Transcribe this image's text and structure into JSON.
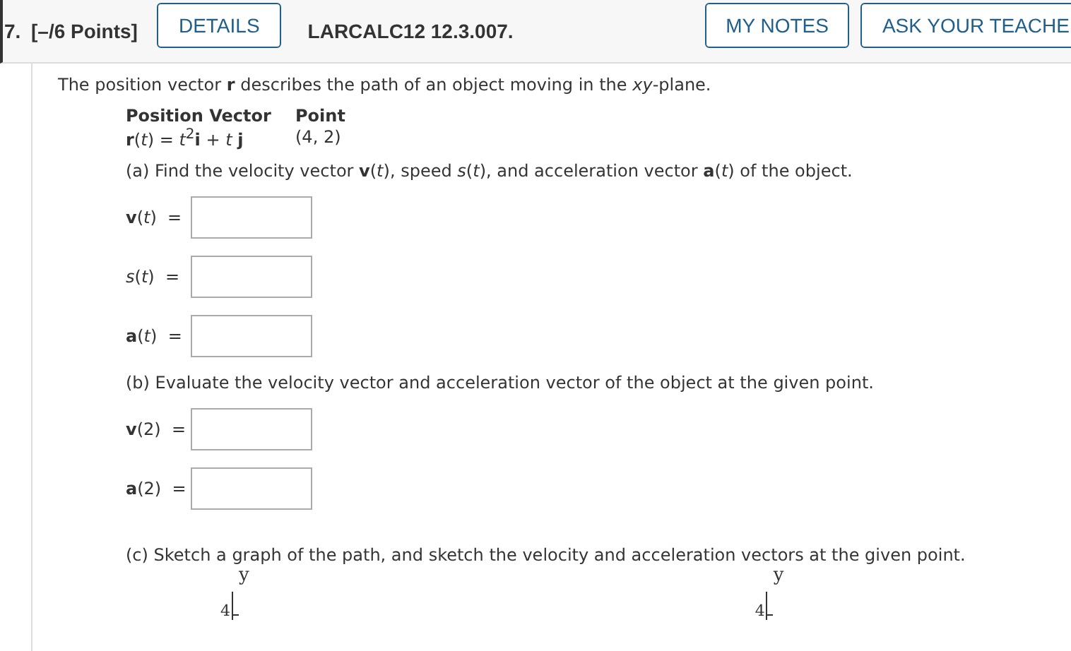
{
  "header": {
    "number": "7.",
    "points": "[–/6 Points]",
    "details_button": "DETAILS",
    "problem_id": "LARCALC12 12.3.007.",
    "buttons": [
      "MY NOTES",
      "ASK YOUR TEACHE"
    ]
  },
  "intro": "The position vector **r** describes the path of an object moving in the *xy*-plane.",
  "given": {
    "headers": [
      "Position Vector",
      "Point"
    ],
    "values": [
      "**r**(*t*) = *t*$^{2}$**i** + *t* **j**",
      "(4, 2)"
    ]
  },
  "parts": [
    {
      "prompt": "(a) Find the velocity vector **v**(*t*), speed *s*(*t*), and acceleration vector **a**(*t*) of the object.",
      "answers": [
        {
          "label": "**v**(*t*)  ="
        },
        {
          "label": "*s*(*t*)  ="
        },
        {
          "label": "**a**(*t*)  ="
        }
      ]
    },
    {
      "prompt": "(b) Evaluate the velocity vector and acceleration vector of the object at the given point.",
      "answers": [
        {
          "label": "**v**(2)  ="
        },
        {
          "label": "**a**(2)  ="
        }
      ]
    },
    {
      "prompt": "(c) Sketch a graph of the path, and sketch the velocity and acceleration vectors at the given point."
    }
  ],
  "graphs": [
    {
      "axis_label": "y",
      "tick": "4"
    },
    {
      "axis_label": "y",
      "tick": "4"
    }
  ]
}
